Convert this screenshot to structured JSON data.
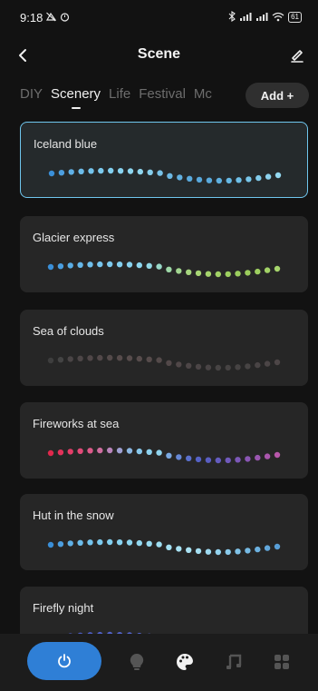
{
  "status": {
    "time": "9:18",
    "battery": "61"
  },
  "header": {
    "title": "Scene"
  },
  "tabs": [
    {
      "label": "DIY",
      "active": false
    },
    {
      "label": "Scenery",
      "active": true
    },
    {
      "label": "Life",
      "active": false
    },
    {
      "label": "Festival",
      "active": false
    },
    {
      "label": "Mc",
      "active": false
    }
  ],
  "add_button": {
    "label": "Add +"
  },
  "scenes": [
    {
      "name": "Iceland blue",
      "selected": true,
      "colors": [
        "#3a8fd8",
        "#4d9fe0",
        "#5fb0e6",
        "#6cbcea",
        "#74c4ed",
        "#7ccaee",
        "#82cfef",
        "#88d3f0",
        "#8dd6f0",
        "#8fd6ef",
        "#86ceec",
        "#78c2e8",
        "#6cb8e4",
        "#62b0e0",
        "#5aaadd",
        "#58a8dc",
        "#5aaadd",
        "#5fb0e0",
        "#66b8e4",
        "#6fc0e8",
        "#78c6ea",
        "#82ccec",
        "#8cd2ee",
        "#94d8f0"
      ]
    },
    {
      "name": "Glacier express",
      "selected": false,
      "colors": [
        "#3a8fd8",
        "#4a9ee0",
        "#5aaee6",
        "#66b8ea",
        "#70c0ec",
        "#78c6ee",
        "#7ecaee",
        "#84cfef",
        "#88d2ef",
        "#8dd6ef",
        "#92d8e6",
        "#98d8c8",
        "#9ed8a8",
        "#a2d690",
        "#a6d67e",
        "#a8d674",
        "#a6d46c",
        "#a2d266",
        "#9ed060",
        "#9cce5e",
        "#9ccd5c",
        "#9ecf60",
        "#a2d266",
        "#a6d56c"
      ]
    },
    {
      "name": "Sea of clouds",
      "selected": false,
      "colors": [
        "#3e3e3e",
        "#444",
        "#4a4546",
        "#4d4647",
        "#504748",
        "#524849",
        "#544a4a",
        "#564b4b",
        "#574c4c",
        "#574c4c",
        "#564b4b",
        "#544a4a",
        "#524849",
        "#504748",
        "#4d4647",
        "#4b4546",
        "#494445",
        "#474444",
        "#464343",
        "#464343",
        "#474444",
        "#494445",
        "#4b4546",
        "#4d4647"
      ]
    },
    {
      "name": "Fireworks at sea",
      "selected": false,
      "colors": [
        "#e0284c",
        "#e3325a",
        "#e43d68",
        "#e24a78",
        "#dd5a8a",
        "#cf6ea0",
        "#b985bb",
        "#9fa0d2",
        "#8cb8e3",
        "#88c8ec",
        "#8dd2ef",
        "#90d4ee",
        "#7aa9e2",
        "#6688d6",
        "#5a70cc",
        "#5562c6",
        "#5a5ec2",
        "#645cbf",
        "#705abc",
        "#7c58b8",
        "#8a56b4",
        "#9a56b0",
        "#aa56ad",
        "#b857aa"
      ]
    },
    {
      "name": "Hut in the snow",
      "selected": false,
      "colors": [
        "#3a8fd8",
        "#4d9fe0",
        "#5fb0e6",
        "#6cbcea",
        "#74c4ed",
        "#7ccaee",
        "#82cfef",
        "#88d3f0",
        "#8dd6f0",
        "#92d8f0",
        "#98dbf1",
        "#9edef2",
        "#a3e0f2",
        "#a8e2f3",
        "#aae2f3",
        "#a6dff2",
        "#9edaf1",
        "#94d3ee",
        "#8acbec",
        "#80c3e8",
        "#76bae4",
        "#6cb1e0",
        "#62a8dc",
        "#589fd8"
      ]
    },
    {
      "name": "Firefly night",
      "selected": false,
      "colors": [
        "#3d4a9a",
        "#4250a8",
        "#4756b4",
        "#4b5abd",
        "#4e5dc2",
        "#5060c6",
        "#5262c8",
        "#5363c9",
        "#5464ca",
        "#5363c9",
        "#5262c8",
        "#5060c6",
        "#4e5dc2",
        "#4b5abd",
        "#4756b4",
        "#4250a8",
        "#3d4a9a",
        "#39458f",
        "#364186",
        "#333e7e",
        "#313b78",
        "#303a75",
        "#303a75",
        "#313b78"
      ]
    }
  ],
  "nav": {
    "power_icon": "power-icon",
    "items": [
      "bulb-icon",
      "palette-icon",
      "music-icon",
      "grid-icon"
    ],
    "accent": "#2f7fd6"
  }
}
